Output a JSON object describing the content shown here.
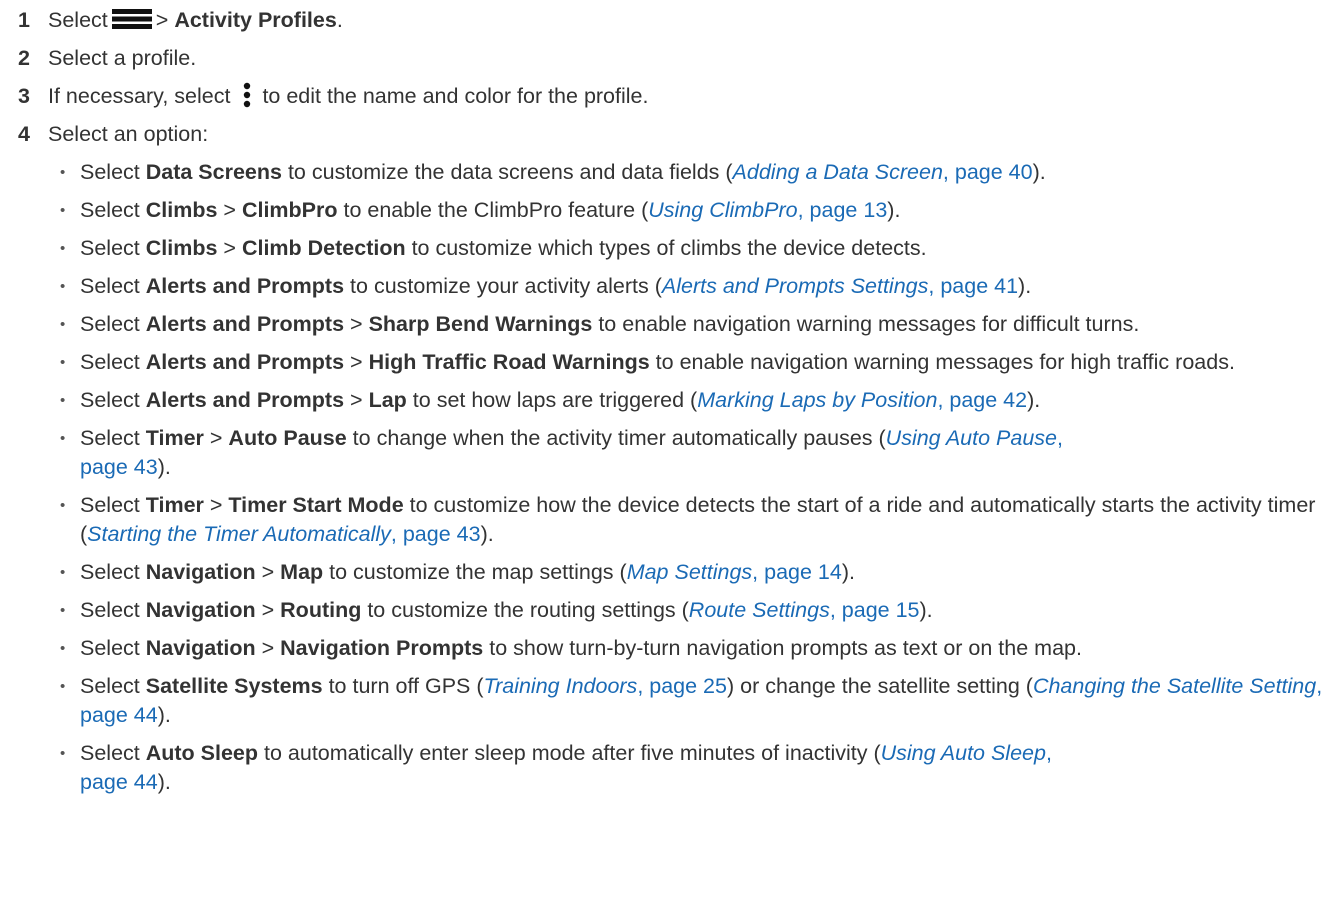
{
  "steps": [
    {
      "num": "1",
      "pre": "Select",
      "sep": ">",
      "bold": "Activity Profiles",
      "post": "."
    },
    {
      "num": "2",
      "text": "Select a profile."
    },
    {
      "num": "3",
      "pre": "If necessary, select",
      "post": "to edit the name and color for the profile."
    },
    {
      "num": "4",
      "text": "Select an option:"
    }
  ],
  "icons": [
    "menu-icon",
    "more-vertical-icon"
  ],
  "options": [
    {
      "t1": "Select ",
      "b1": "Data Screens",
      "t2": " to customize the data screens and data fields (",
      "ri": "Adding a Data Screen",
      "rp": ", page 40",
      "t3": ")."
    },
    {
      "t1": "Select ",
      "b1": "Climbs",
      "t2": " > ",
      "b2": "ClimbPro",
      "t3": " to enable the ClimbPro feature (",
      "ri": "Using ClimbPro",
      "rp": ", page 13",
      "t4": ")."
    },
    {
      "t1": "Select ",
      "b1": "Climbs",
      "t2": " > ",
      "b2": "Climb Detection",
      "t3": " to customize which types of climbs the device detects."
    },
    {
      "t1": "Select ",
      "b1": "Alerts and Prompts",
      "t2": " to customize your activity alerts (",
      "ri": "Alerts and Prompts Settings",
      "rp": ", page 41",
      "t3": ")."
    },
    {
      "t1": "Select ",
      "b1": "Alerts and Prompts",
      "t2": " > ",
      "b2": "Sharp Bend Warnings",
      "t3": " to enable navigation warning messages for difficult turns."
    },
    {
      "t1": "Select ",
      "b1": "Alerts and Prompts",
      "t2": " > ",
      "b2": "High Traffic Road Warnings",
      "t3": " to enable navigation warning messages for high traffic roads."
    },
    {
      "t1": "Select ",
      "b1": "Alerts and Prompts",
      "t2": " > ",
      "b2": "Lap",
      "t3": " to set how laps are triggered (",
      "ri": "Marking Laps by Position",
      "rp": ", page 42",
      "t4": ")."
    },
    {
      "t1": "Select ",
      "b1": "Timer",
      "t2": " > ",
      "b2": "Auto Pause",
      "t3": " to change when the activity timer automatically pauses (",
      "ri": "Using Auto Pause",
      "rp": ",\npage 43",
      "t4": ")."
    },
    {
      "t1": "Select ",
      "b1": "Timer",
      "t2": " > ",
      "b2": "Timer Start Mode",
      "t3": " to customize how the device detects the start of a ride and automatically starts the activity timer (",
      "ri": "Starting the Timer Automatically",
      "rp": ", page 43",
      "t4": ")."
    },
    {
      "t1": "Select ",
      "b1": "Navigation",
      "t2": " > ",
      "b2": "Map",
      "t3": " to customize the map settings (",
      "ri": "Map Settings",
      "rp": ", page 14",
      "t4": ")."
    },
    {
      "t1": "Select ",
      "b1": "Navigation",
      "t2": " > ",
      "b2": "Routing",
      "t3": " to customize the routing settings (",
      "ri": "Route Settings",
      "rp": ", page 15",
      "t4": ")."
    },
    {
      "t1": "Select ",
      "b1": "Navigation",
      "t2": " > ",
      "b2": "Navigation Prompts",
      "t3": " to show turn-by-turn navigation prompts as text or on the map."
    },
    {
      "t1": "Select ",
      "b1": "Satellite Systems",
      "t2": " to turn off GPS (",
      "ri": "Training Indoors",
      "rp": ", page 25",
      "t3": ") or change the satellite setting (",
      "ri2": "Changing the Satellite Setting",
      "rp2": ", page 44",
      "t4": ")."
    },
    {
      "t1": "Select ",
      "b1": "Auto Sleep",
      "t2": " to automatically enter sleep mode after five minutes of inactivity (",
      "ri": "Using Auto Sleep",
      "rp": ",\npage 44",
      "t4": ")."
    }
  ],
  "colors": {
    "text": "#333333",
    "link": "#1a6ab5"
  }
}
